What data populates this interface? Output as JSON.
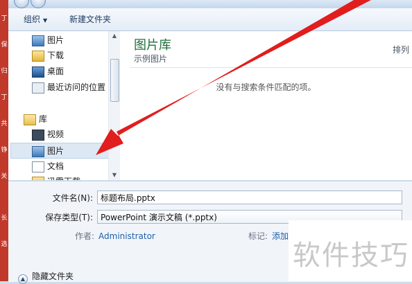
{
  "sidebar_strip": [
    "丁",
    "保",
    "归",
    "丁",
    "共",
    "铮",
    "关",
    "长",
    "选"
  ],
  "toolbar": {
    "organize_label": "组织",
    "new_folder_label": "新建文件夹"
  },
  "nav": {
    "items": [
      {
        "label": "图片",
        "icon": "pictures-icon"
      },
      {
        "label": "下载",
        "icon": "downloads-icon"
      },
      {
        "label": "桌面",
        "icon": "desktop-icon"
      },
      {
        "label": "最近访问的位置",
        "icon": "recent-places-icon"
      }
    ],
    "library_group": {
      "label": "库",
      "icon": "library-icon"
    },
    "library_items": [
      {
        "label": "视频",
        "icon": "videos-icon"
      },
      {
        "label": "图片",
        "icon": "pictures-icon",
        "selected": true
      },
      {
        "label": "文档",
        "icon": "documents-icon"
      },
      {
        "label": "迅雷下载",
        "icon": "thunder-download-icon"
      }
    ]
  },
  "content": {
    "title": "图片库",
    "subtitle": "示例图片",
    "arrange_label": "排列",
    "empty_message": "没有与搜索条件匹配的项。"
  },
  "form": {
    "filename_label": "文件名(N):",
    "filename_value": "标题布局.pptx",
    "savetype_label": "保存类型(T):",
    "savetype_value": "PowerPoint 演示文稿 (*.pptx)",
    "author_label": "作者:",
    "author_value": "Administrator",
    "tags_label": "标记:",
    "tags_value": "添加"
  },
  "footer": {
    "hide_folders_label": "隐藏文件夹"
  },
  "watermark": {
    "text": "软件技巧"
  },
  "colors": {
    "arrow": "#e11d1d",
    "library_title": "#1f6f3b",
    "link": "#1f5fa8",
    "selection": "#dde8f4"
  }
}
